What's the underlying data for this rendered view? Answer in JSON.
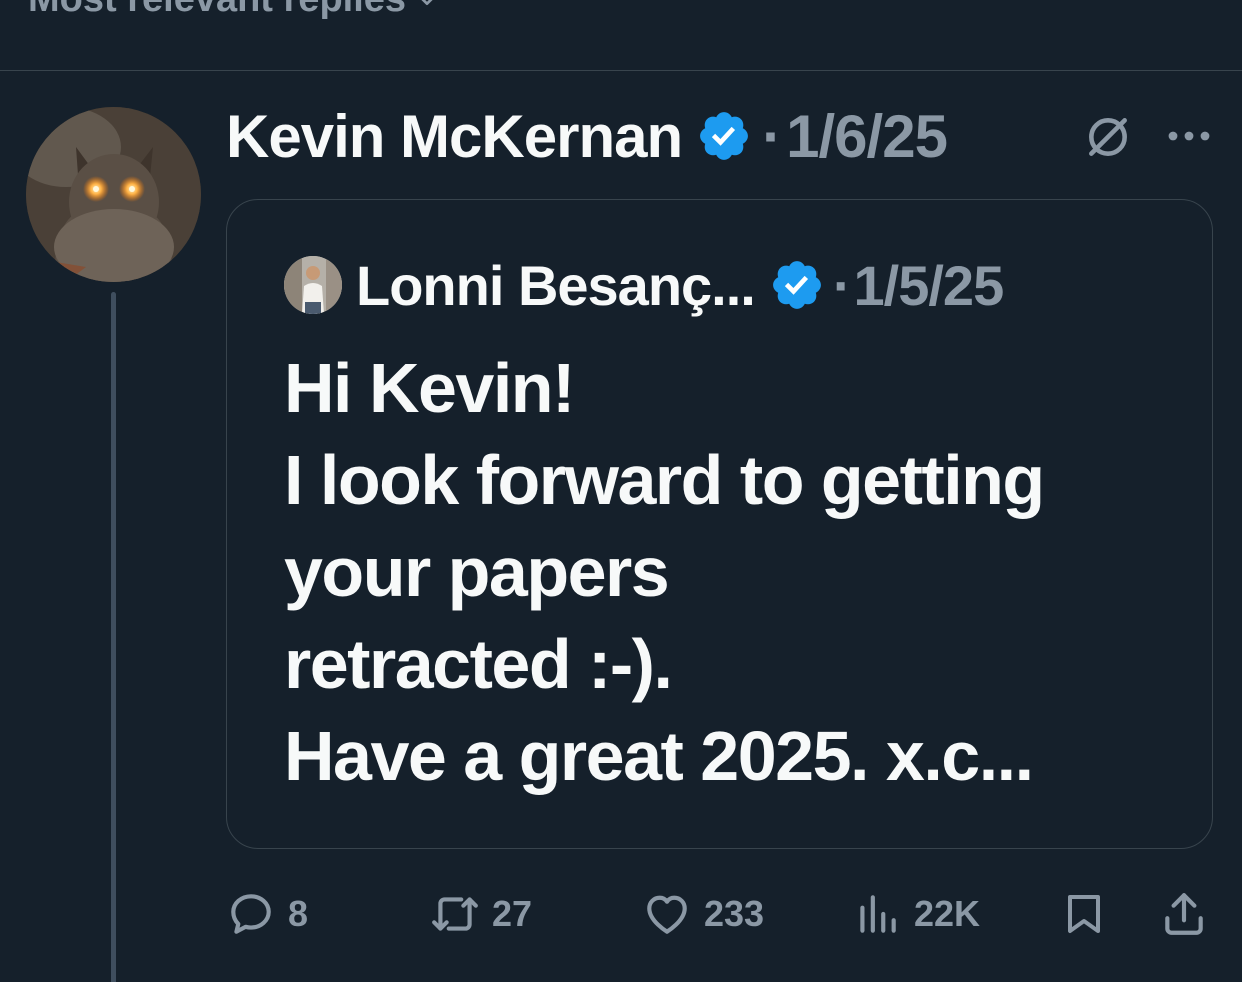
{
  "sort": {
    "label": "Most relevant replies"
  },
  "post": {
    "author_name": "Kevin McKernan",
    "date": "1/6/25",
    "separator": "·",
    "quote": {
      "author_name": "Lonni Besanç...",
      "date": "1/5/25",
      "separator": "·",
      "text_lines": [
        "Hi Kevin!",
        "I look forward to getting",
        "your papers",
        "retracted :-).",
        "Have a great 2025. x.c..."
      ]
    },
    "actions": {
      "replies": "8",
      "reposts": "27",
      "likes": "233",
      "views": "22K"
    }
  },
  "icons": {
    "verified": "verified-badge-icon",
    "grok": "grok-icon",
    "more": "more-icon",
    "reply": "reply-icon",
    "repost": "repost-icon",
    "like": "heart-icon",
    "views": "views-icon",
    "bookmark": "bookmark-icon",
    "share": "share-icon"
  },
  "colors": {
    "background": "#15202b",
    "text_primary": "#f7f9f9",
    "text_secondary": "#8b98a5",
    "verified_blue": "#1d9bf0",
    "border": "#38444d"
  }
}
